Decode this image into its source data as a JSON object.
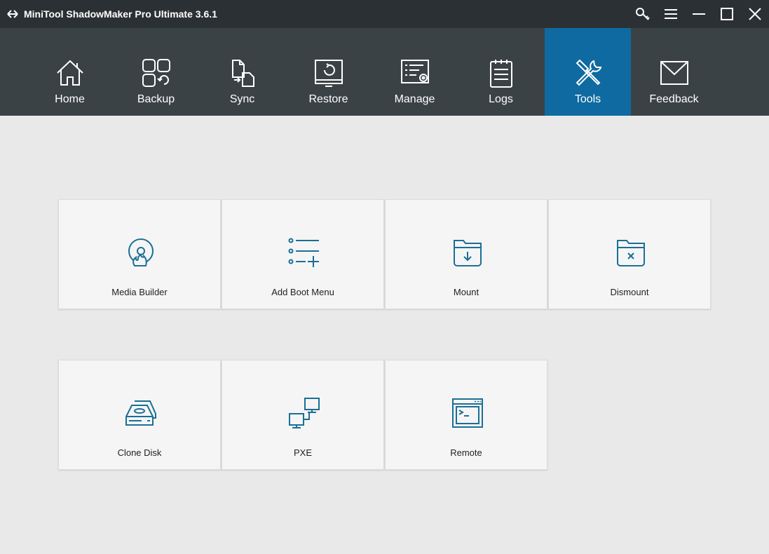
{
  "window": {
    "title": "MiniTool ShadowMaker Pro Ultimate 3.6.1",
    "controls": [
      "key-icon",
      "menu-icon",
      "minimize-icon",
      "maximize-icon",
      "close-icon"
    ]
  },
  "nav": {
    "items": [
      {
        "label": "Home",
        "icon": "home-icon"
      },
      {
        "label": "Backup",
        "icon": "backup-icon"
      },
      {
        "label": "Sync",
        "icon": "sync-icon"
      },
      {
        "label": "Restore",
        "icon": "restore-icon"
      },
      {
        "label": "Manage",
        "icon": "manage-icon"
      },
      {
        "label": "Logs",
        "icon": "logs-icon"
      },
      {
        "label": "Tools",
        "icon": "tools-icon",
        "active": true
      },
      {
        "label": "Feedback",
        "icon": "feedback-icon"
      }
    ]
  },
  "tools": {
    "cards": [
      {
        "label": "Media Builder",
        "icon": "media-builder-icon"
      },
      {
        "label": "Add Boot Menu",
        "icon": "add-boot-menu-icon"
      },
      {
        "label": "Mount",
        "icon": "mount-icon"
      },
      {
        "label": "Dismount",
        "icon": "dismount-icon"
      },
      {
        "label": "Clone Disk",
        "icon": "clone-disk-icon"
      },
      {
        "label": "PXE",
        "icon": "pxe-icon"
      },
      {
        "label": "Remote",
        "icon": "remote-icon"
      }
    ]
  },
  "colors": {
    "titlebar": "#2b3034",
    "navbar": "#3b4246",
    "active_tab": "#0f6aa1",
    "content_bg": "#e9e9e9",
    "card_bg": "#f5f5f5",
    "icon_accent": "#1a6f96"
  }
}
